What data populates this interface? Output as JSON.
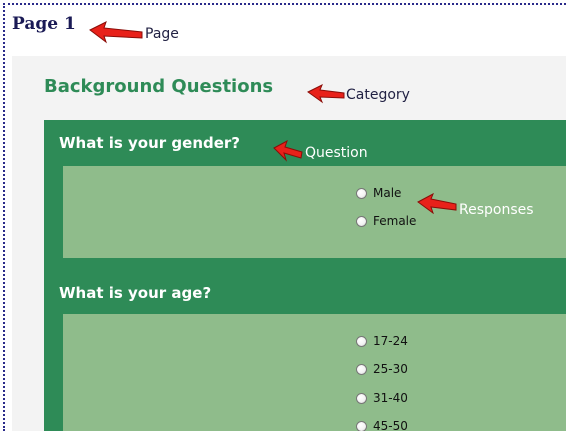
{
  "page": {
    "title": "Page 1"
  },
  "category": {
    "title": "Background Questions"
  },
  "questions": [
    {
      "text": "What is your gender?",
      "options": [
        "Male",
        "Female"
      ]
    },
    {
      "text": "What is your age?",
      "options": [
        "17-24",
        "25-30",
        "31-40",
        "45-50"
      ]
    }
  ],
  "annotations": {
    "page": "Page",
    "category": "Category",
    "question": "Question",
    "responses": "Responses"
  },
  "colors": {
    "category_green": "#2e8b57",
    "panel_green": "#2e8b57",
    "answers_green": "#8fbc8b",
    "arrow_red": "#e8211a"
  },
  "icons": {
    "annotation_arrow": "red-arrow-icon",
    "radio": "radio-button"
  }
}
